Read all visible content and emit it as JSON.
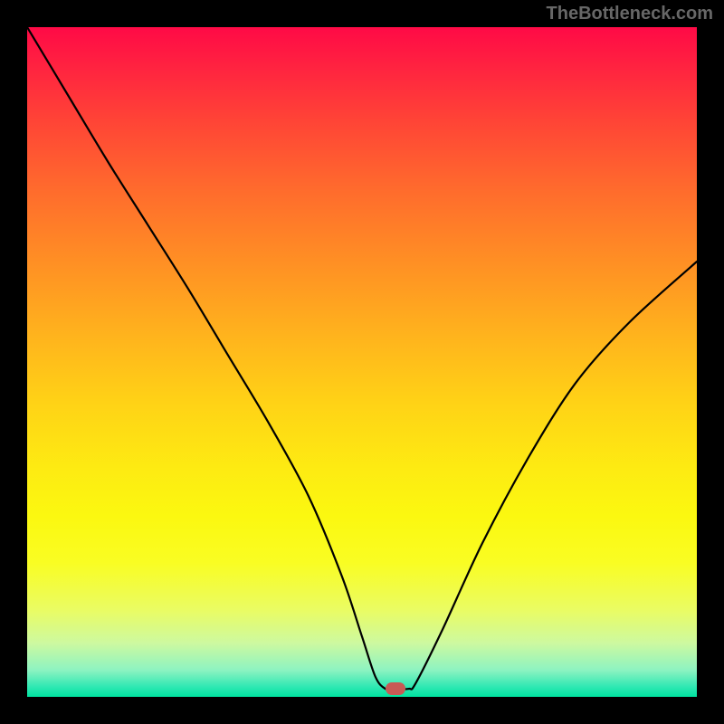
{
  "watermark": "TheBottleneck.com",
  "chart_data": {
    "type": "line",
    "title": "",
    "xlabel": "",
    "ylabel": "",
    "xlim": [
      0,
      100
    ],
    "ylim": [
      0,
      100
    ],
    "grid": false,
    "legend": false,
    "annotations": [],
    "series": [
      {
        "name": "curve",
        "x": [
          0,
          6,
          12,
          18,
          24,
          30,
          36,
          42,
          47,
          50,
          52,
          53.5,
          55,
          57,
          58,
          62,
          68,
          75,
          82,
          90,
          100
        ],
        "y": [
          100,
          90,
          80,
          70.5,
          61,
          51,
          41,
          30,
          18,
          9,
          3,
          1.2,
          1.2,
          1.2,
          2,
          10,
          23,
          36,
          47,
          56,
          65
        ]
      }
    ],
    "background_gradient": {
      "top_color": "#ff0a46",
      "bottom_color": "#00e3a0"
    },
    "marker": {
      "x": 55,
      "y": 1.2,
      "color": "#c85a55"
    }
  }
}
